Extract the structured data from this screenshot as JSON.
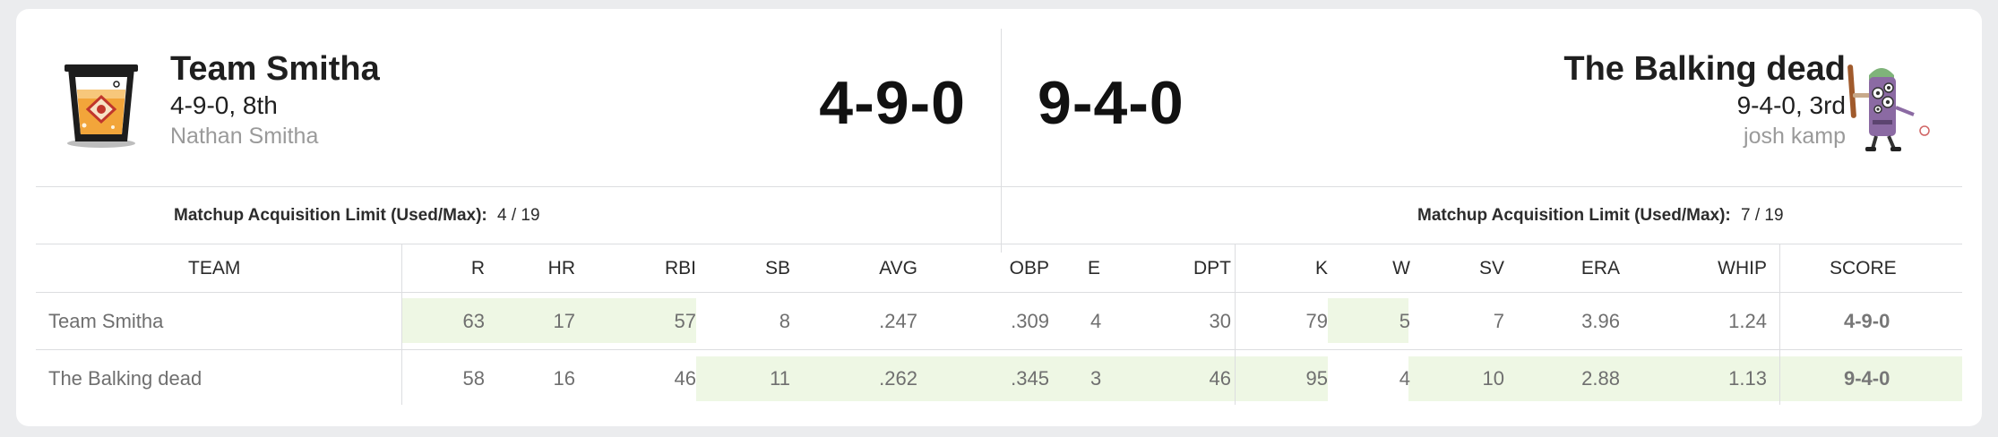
{
  "teams": [
    {
      "name": "Team Smitha",
      "record_line": "4-9-0, 8th",
      "manager": "Nathan Smitha",
      "matchup_score": "4-9-0",
      "acq_used_max": "4 / 19"
    },
    {
      "name": "The Balking dead",
      "record_line": "9-4-0, 3rd",
      "manager": "josh kamp",
      "matchup_score": "9-4-0",
      "acq_used_max": "7 / 19"
    }
  ],
  "acq_label": "Matchup Acquisition Limit (Used/Max):",
  "table": {
    "headers": [
      "TEAM",
      "R",
      "HR",
      "RBI",
      "SB",
      "AVG",
      "OBP",
      "E",
      "DPT",
      "K",
      "W",
      "SV",
      "ERA",
      "WHIP",
      "SCORE"
    ],
    "rows": [
      {
        "team": "Team Smitha",
        "values": [
          "63",
          "17",
          "57",
          "8",
          ".247",
          ".309",
          "4",
          "30",
          "79",
          "5",
          "7",
          "3.96",
          "1.24"
        ],
        "score": "4-9-0"
      },
      {
        "team": "The Balking dead",
        "values": [
          "58",
          "16",
          "46",
          "11",
          ".262",
          ".345",
          "3",
          "46",
          "95",
          "4",
          "10",
          "2.88",
          "1.13"
        ],
        "score": "9-4-0"
      }
    ],
    "category_winner_colors": {
      "highlight": "#eef7e4"
    }
  },
  "icons": {
    "team1_avatar": "drink-cup-icon",
    "team2_avatar": "zombie-batter-icon"
  }
}
